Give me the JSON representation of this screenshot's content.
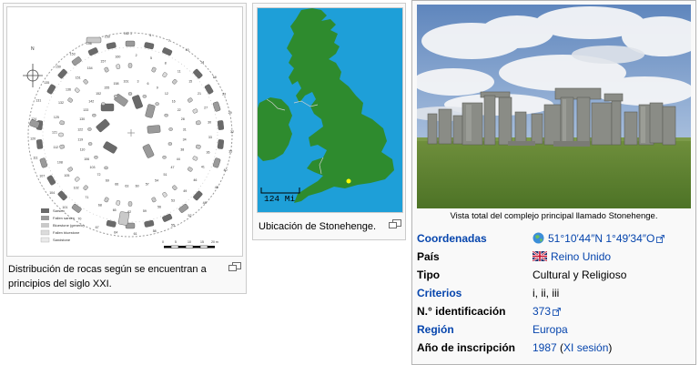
{
  "plan": {
    "caption": "Distribución de rocas según se encuentran a principios del siglo XXI.",
    "legend": [
      "Sarsen",
      "Fallen sarsen",
      "Bluestone (generic)",
      "Fallen bluestone",
      "Sandstone"
    ],
    "scale_numbers": [
      "0",
      "5",
      "10",
      "15",
      "20 m"
    ],
    "stone_numbers": [
      "1",
      "2",
      "3",
      "4",
      "5",
      "6",
      "7",
      "8",
      "9",
      "10",
      "11",
      "12",
      "14",
      "15",
      "16",
      "19",
      "21",
      "22",
      "23",
      "27",
      "28",
      "29",
      "30",
      "31",
      "32",
      "33",
      "34",
      "35",
      "36",
      "38",
      "40",
      "41",
      "44",
      "45",
      "46",
      "47",
      "48",
      "49",
      "51",
      "52",
      "53",
      "54",
      "55",
      "56",
      "57",
      "58",
      "59",
      "60",
      "61",
      "62",
      "63",
      "64",
      "65",
      "66",
      "67",
      "68",
      "69",
      "70",
      "71",
      "72",
      "101",
      "102",
      "103",
      "104",
      "105",
      "106",
      "107",
      "108",
      "110",
      "111",
      "112",
      "119",
      "120",
      "121",
      "122",
      "124",
      "125",
      "130",
      "131",
      "132",
      "133",
      "135",
      "136",
      "142",
      "150",
      "151",
      "152",
      "153",
      "154",
      "155",
      "156",
      "157",
      "158",
      "159",
      "160",
      "161",
      "162"
    ],
    "north_label": "N"
  },
  "map": {
    "caption": "Ubicación de Stonehenge.",
    "scale_label": "124 Mi",
    "marker_color": "#ffff00",
    "sea_color": "#1e9fd8",
    "land_color": "#2e8b2e"
  },
  "photo": {
    "caption": "Vista total del complejo principal llamado Stonehenge."
  },
  "infobox": {
    "rows": [
      {
        "label": "Coordenadas",
        "label_link": true,
        "value": "51°10′44″N 1°49′34″O",
        "value_link": true,
        "external": true,
        "icon": "globe-icon"
      },
      {
        "label": "País",
        "label_link": false,
        "value": "Reino Unido",
        "value_link": true,
        "external": false,
        "icon": "uk-flag-icon"
      },
      {
        "label": "Tipo",
        "label_link": false,
        "value": "Cultural y Religioso",
        "value_link": false,
        "external": false,
        "icon": ""
      },
      {
        "label": "Criterios",
        "label_link": true,
        "value": "i, ii, iii",
        "value_link": false,
        "external": false,
        "icon": ""
      },
      {
        "label": "N.° identificación",
        "label_link": false,
        "value": "373",
        "value_link": true,
        "external": true,
        "icon": ""
      },
      {
        "label": "Región",
        "label_link": true,
        "value": "Europa",
        "value_link": true,
        "external": false,
        "icon": ""
      },
      {
        "label": "Año de inscripción",
        "label_link": false,
        "value": "1987",
        "value_link": true,
        "external": false,
        "value_suffix": " (XI sesión)",
        "suffix_link": "XI sesión",
        "icon": ""
      }
    ]
  }
}
